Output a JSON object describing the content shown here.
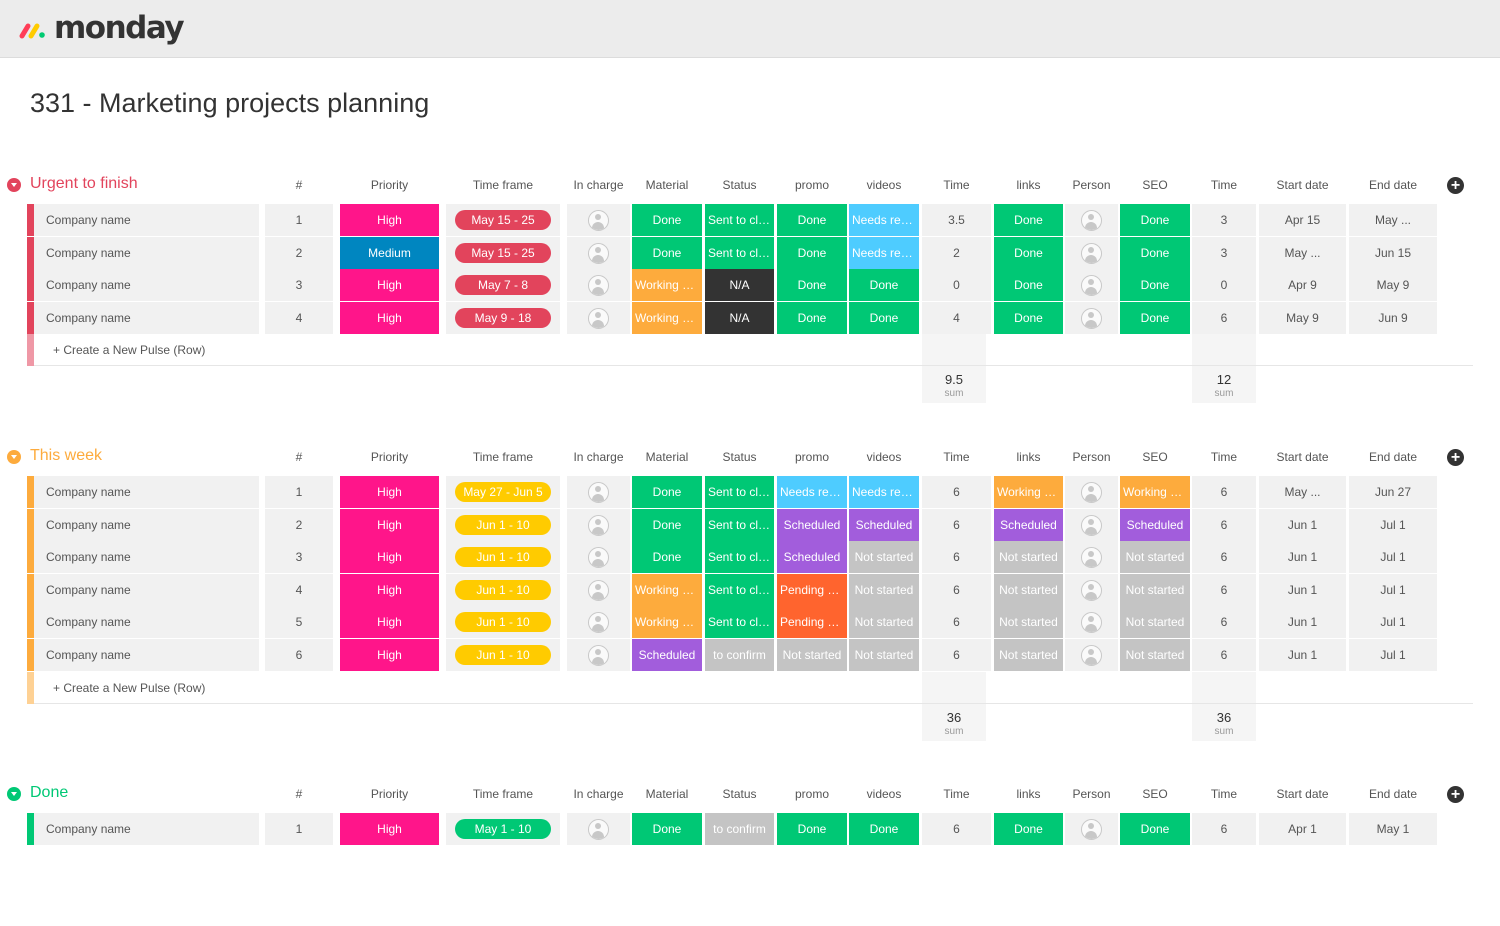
{
  "app": {
    "logo_text": "monday"
  },
  "page": {
    "title": "331 - Marketing projects planning"
  },
  "colors": {
    "red_group": "#e2445c",
    "yellow_group": "#fdab3d",
    "green_group": "#00c875",
    "done": "#00c875",
    "high": "#ff158a",
    "medium": "#0086c0",
    "working": "#fdab3d",
    "na": "#333333",
    "needs_review": "#4eccff",
    "scheduled": "#a25ddc",
    "not_started": "#c4c4c4",
    "pending": "#ff642e",
    "sent": "#00c875",
    "pill_red": "#e2445c",
    "pill_yellow": "#ffcb00",
    "pill_green": "#00c875"
  },
  "columns": [
    "#",
    "Priority",
    "Time frame",
    "In charge",
    "Material",
    "Status",
    "promo",
    "videos",
    "Time",
    "links",
    "Person",
    "SEO",
    "Time",
    "Start date",
    "End date"
  ],
  "create_label": "+ Create a New Pulse (Row)",
  "sum_label": "sum",
  "groups": [
    {
      "title": "Urgent to finish",
      "color": "#e2445c",
      "pill_color": "#e2445c",
      "sums": [
        "9.5",
        "12"
      ],
      "rows": [
        {
          "name": "Company name",
          "num": "1",
          "priority": {
            "t": "High",
            "c": "#ff158a"
          },
          "timeframe": "May 15 - 25",
          "material": {
            "t": "Done",
            "c": "#00c875"
          },
          "status": {
            "t": "Sent to client",
            "c": "#00c875"
          },
          "promo": {
            "t": "Done",
            "c": "#00c875"
          },
          "videos": {
            "t": "Needs revie...",
            "c": "#4eccff"
          },
          "time1": "3.5",
          "links": {
            "t": "Done",
            "c": "#00c875"
          },
          "seo": {
            "t": "Done",
            "c": "#00c875"
          },
          "time2": "3",
          "start": "Apr 15",
          "end": "May ..."
        },
        {
          "name": "Company name",
          "num": "2",
          "priority": {
            "t": "Medium",
            "c": "#0086c0"
          },
          "timeframe": "May 15 - 25",
          "material": {
            "t": "Done",
            "c": "#00c875"
          },
          "status": {
            "t": "Sent to client",
            "c": "#00c875"
          },
          "promo": {
            "t": "Done",
            "c": "#00c875"
          },
          "videos": {
            "t": "Needs revie...",
            "c": "#4eccff"
          },
          "time1": "2",
          "links": {
            "t": "Done",
            "c": "#00c875"
          },
          "seo": {
            "t": "Done",
            "c": "#00c875"
          },
          "time2": "3",
          "start": "May ...",
          "end": "Jun 15"
        },
        {
          "name": "Company name",
          "num": "3",
          "priority": {
            "t": "High",
            "c": "#ff158a"
          },
          "timeframe": "May 7 - 8",
          "material": {
            "t": "Working on it",
            "c": "#fdab3d"
          },
          "status": {
            "t": "N/A",
            "c": "#333333"
          },
          "promo": {
            "t": "Done",
            "c": "#00c875"
          },
          "videos": {
            "t": "Done",
            "c": "#00c875"
          },
          "time1": "0",
          "links": {
            "t": "Done",
            "c": "#00c875"
          },
          "seo": {
            "t": "Done",
            "c": "#00c875"
          },
          "time2": "0",
          "start": "Apr 9",
          "end": "May 9"
        },
        {
          "name": "Company name",
          "num": "4",
          "priority": {
            "t": "High",
            "c": "#ff158a"
          },
          "timeframe": "May 9 - 18",
          "material": {
            "t": "Working on it",
            "c": "#fdab3d"
          },
          "status": {
            "t": "N/A",
            "c": "#333333"
          },
          "promo": {
            "t": "Done",
            "c": "#00c875"
          },
          "videos": {
            "t": "Done",
            "c": "#00c875"
          },
          "time1": "4",
          "links": {
            "t": "Done",
            "c": "#00c875"
          },
          "seo": {
            "t": "Done",
            "c": "#00c875"
          },
          "time2": "6",
          "start": "May 9",
          "end": "Jun 9"
        }
      ]
    },
    {
      "title": "This week",
      "color": "#fdab3d",
      "pill_color": "#ffcb00",
      "sums": [
        "36",
        "36"
      ],
      "rows": [
        {
          "name": "Company name",
          "num": "1",
          "priority": {
            "t": "High",
            "c": "#ff158a"
          },
          "timeframe": "May 27 - Jun 5",
          "material": {
            "t": "Done",
            "c": "#00c875"
          },
          "status": {
            "t": "Sent to client",
            "c": "#00c875"
          },
          "promo": {
            "t": "Needs revie...",
            "c": "#4eccff"
          },
          "videos": {
            "t": "Needs revie...",
            "c": "#4eccff"
          },
          "time1": "6",
          "links": {
            "t": "Working on it",
            "c": "#fdab3d"
          },
          "seo": {
            "t": "Working on it",
            "c": "#fdab3d"
          },
          "time2": "6",
          "start": "May ...",
          "end": "Jun 27"
        },
        {
          "name": "Company name",
          "num": "2",
          "priority": {
            "t": "High",
            "c": "#ff158a"
          },
          "timeframe": "Jun 1 - 10",
          "material": {
            "t": "Done",
            "c": "#00c875"
          },
          "status": {
            "t": "Sent to client",
            "c": "#00c875"
          },
          "promo": {
            "t": "Scheduled",
            "c": "#a25ddc"
          },
          "videos": {
            "t": "Scheduled",
            "c": "#a25ddc"
          },
          "time1": "6",
          "links": {
            "t": "Scheduled",
            "c": "#a25ddc"
          },
          "seo": {
            "t": "Scheduled",
            "c": "#a25ddc"
          },
          "time2": "6",
          "start": "Jun 1",
          "end": "Jul 1"
        },
        {
          "name": "Company name",
          "num": "3",
          "priority": {
            "t": "High",
            "c": "#ff158a"
          },
          "timeframe": "Jun 1 - 10",
          "material": {
            "t": "Done",
            "c": "#00c875"
          },
          "status": {
            "t": "Sent to client",
            "c": "#00c875"
          },
          "promo": {
            "t": "Scheduled",
            "c": "#a25ddc"
          },
          "videos": {
            "t": "Not started",
            "c": "#c4c4c4"
          },
          "time1": "6",
          "links": {
            "t": "Not started",
            "c": "#c4c4c4"
          },
          "seo": {
            "t": "Not started",
            "c": "#c4c4c4"
          },
          "time2": "6",
          "start": "Jun 1",
          "end": "Jul 1"
        },
        {
          "name": "Company name",
          "num": "4",
          "priority": {
            "t": "High",
            "c": "#ff158a"
          },
          "timeframe": "Jun 1 - 10",
          "material": {
            "t": "Working on it",
            "c": "#fdab3d"
          },
          "status": {
            "t": "Sent to client",
            "c": "#00c875"
          },
          "promo": {
            "t": "Pending cu...",
            "c": "#ff642e"
          },
          "videos": {
            "t": "Not started",
            "c": "#c4c4c4"
          },
          "time1": "6",
          "links": {
            "t": "Not started",
            "c": "#c4c4c4"
          },
          "seo": {
            "t": "Not started",
            "c": "#c4c4c4"
          },
          "time2": "6",
          "start": "Jun 1",
          "end": "Jul 1"
        },
        {
          "name": "Company name",
          "num": "5",
          "priority": {
            "t": "High",
            "c": "#ff158a"
          },
          "timeframe": "Jun 1 - 10",
          "material": {
            "t": "Working on it",
            "c": "#fdab3d"
          },
          "status": {
            "t": "Sent to client",
            "c": "#00c875"
          },
          "promo": {
            "t": "Pending cu...",
            "c": "#ff642e"
          },
          "videos": {
            "t": "Not started",
            "c": "#c4c4c4"
          },
          "time1": "6",
          "links": {
            "t": "Not started",
            "c": "#c4c4c4"
          },
          "seo": {
            "t": "Not started",
            "c": "#c4c4c4"
          },
          "time2": "6",
          "start": "Jun 1",
          "end": "Jul 1"
        },
        {
          "name": "Company name",
          "num": "6",
          "priority": {
            "t": "High",
            "c": "#ff158a"
          },
          "timeframe": "Jun 1 - 10",
          "material": {
            "t": "Scheduled",
            "c": "#a25ddc"
          },
          "status": {
            "t": "to confirm",
            "c": "#c4c4c4"
          },
          "promo": {
            "t": "Not started",
            "c": "#c4c4c4"
          },
          "videos": {
            "t": "Not started",
            "c": "#c4c4c4"
          },
          "time1": "6",
          "links": {
            "t": "Not started",
            "c": "#c4c4c4"
          },
          "seo": {
            "t": "Not started",
            "c": "#c4c4c4"
          },
          "time2": "6",
          "start": "Jun 1",
          "end": "Jul 1"
        }
      ]
    },
    {
      "title": "Done",
      "color": "#00c875",
      "pill_color": "#00c875",
      "sums": [],
      "rows": [
        {
          "name": "Company name",
          "num": "1",
          "priority": {
            "t": "High",
            "c": "#ff158a"
          },
          "timeframe": "May 1 - 10",
          "material": {
            "t": "Done",
            "c": "#00c875"
          },
          "status": {
            "t": "to confirm",
            "c": "#c4c4c4"
          },
          "promo": {
            "t": "Done",
            "c": "#00c875"
          },
          "videos": {
            "t": "Done",
            "c": "#00c875"
          },
          "time1": "6",
          "links": {
            "t": "Done",
            "c": "#00c875"
          },
          "seo": {
            "t": "Done",
            "c": "#00c875"
          },
          "time2": "6",
          "start": "Apr 1",
          "end": "May 1"
        }
      ]
    }
  ]
}
